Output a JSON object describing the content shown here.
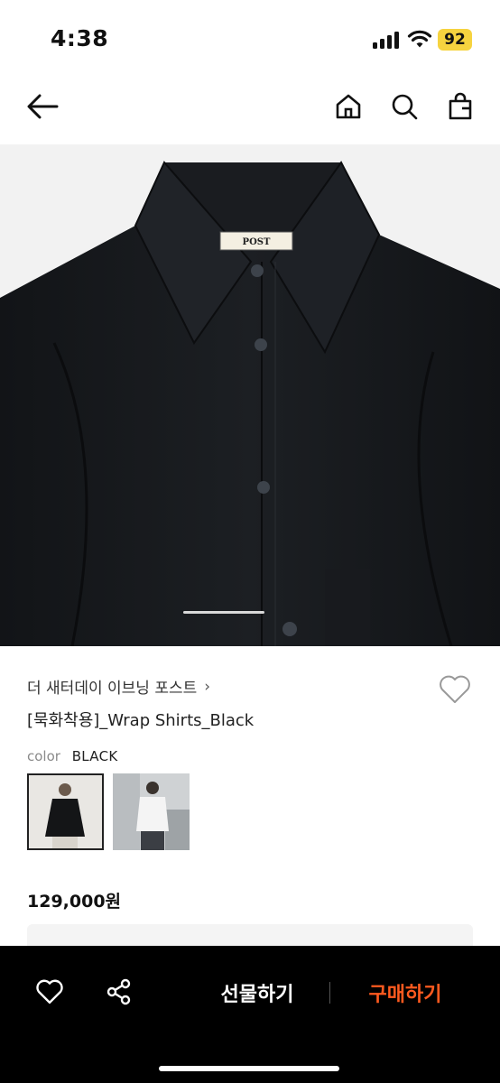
{
  "status_bar": {
    "time": "4:38",
    "battery": "92",
    "battery_color": "#f6d33f"
  },
  "nav": {
    "icons": [
      "back-arrow-icon",
      "home-icon",
      "search-icon",
      "shopping-bag-icon"
    ]
  },
  "product": {
    "brand": "더 새터데이 이브닝 포스트",
    "brand_chevron": "›",
    "title": "[묵화착용]_Wrap Shirts_Black",
    "color_label": "color",
    "color_value": "BLACK",
    "price": "129,000원",
    "label_text": "POST",
    "wishlist_icon": "heart-outline-icon"
  },
  "bottom_bar": {
    "gift_label": "선물하기",
    "buy_label": "구매하기",
    "buy_color": "#ff5a1f",
    "icons": [
      "heart-outline-icon",
      "share-icon"
    ]
  }
}
